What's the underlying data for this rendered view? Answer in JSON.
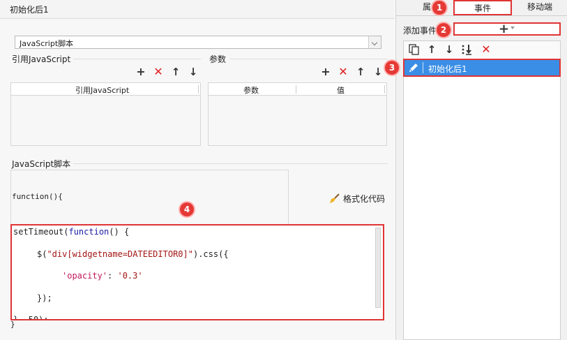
{
  "window": {
    "title": "初始化后1"
  },
  "left": {
    "script_type_select": "JavaScript脚本",
    "ref_js_section": "引用JavaScript",
    "params_section": "参数",
    "ref_js_table_header": "引用JavaScript",
    "params_table_headers": [
      "参数",
      "值"
    ],
    "script_section": "JavaScript脚本",
    "function_header": "function(){",
    "format_code_label": "格式化代码",
    "closing_brace": "}",
    "code_lines": [
      {
        "parts": [
          {
            "t": "setTimeout(",
            "c": "plain"
          },
          {
            "t": "function",
            "c": "kw"
          },
          {
            "t": "() {",
            "c": "plain"
          }
        ]
      },
      {
        "parts": [
          {
            "t": "$(",
            "c": "plain"
          },
          {
            "t": "\"div[widgetname=DATEEDITOR0]\"",
            "c": "str"
          },
          {
            "t": ").css({",
            "c": "plain"
          }
        ]
      },
      {
        "parts": [
          {
            "t": "'opacity'",
            "c": "red-fn"
          },
          {
            "t": ": ",
            "c": "plain"
          },
          {
            "t": "'0.3'",
            "c": "str"
          }
        ]
      },
      {
        "parts": [
          {
            "t": "});",
            "c": "plain"
          }
        ]
      },
      {
        "parts": [
          {
            "t": "}, 50);",
            "c": "plain"
          }
        ]
      }
    ]
  },
  "right": {
    "tabs": [
      "属性",
      "事件",
      "移动端"
    ],
    "active_tab": "事件",
    "add_event_label": "添加事件",
    "add_button_symbol": "+",
    "events": [
      {
        "label": "初始化后1"
      }
    ]
  },
  "badges": [
    "1",
    "2",
    "3",
    "4"
  ],
  "colors": {
    "highlight_red": "#e03434",
    "selected_blue": "#3a8ee6",
    "badge_red": "#e53935"
  }
}
